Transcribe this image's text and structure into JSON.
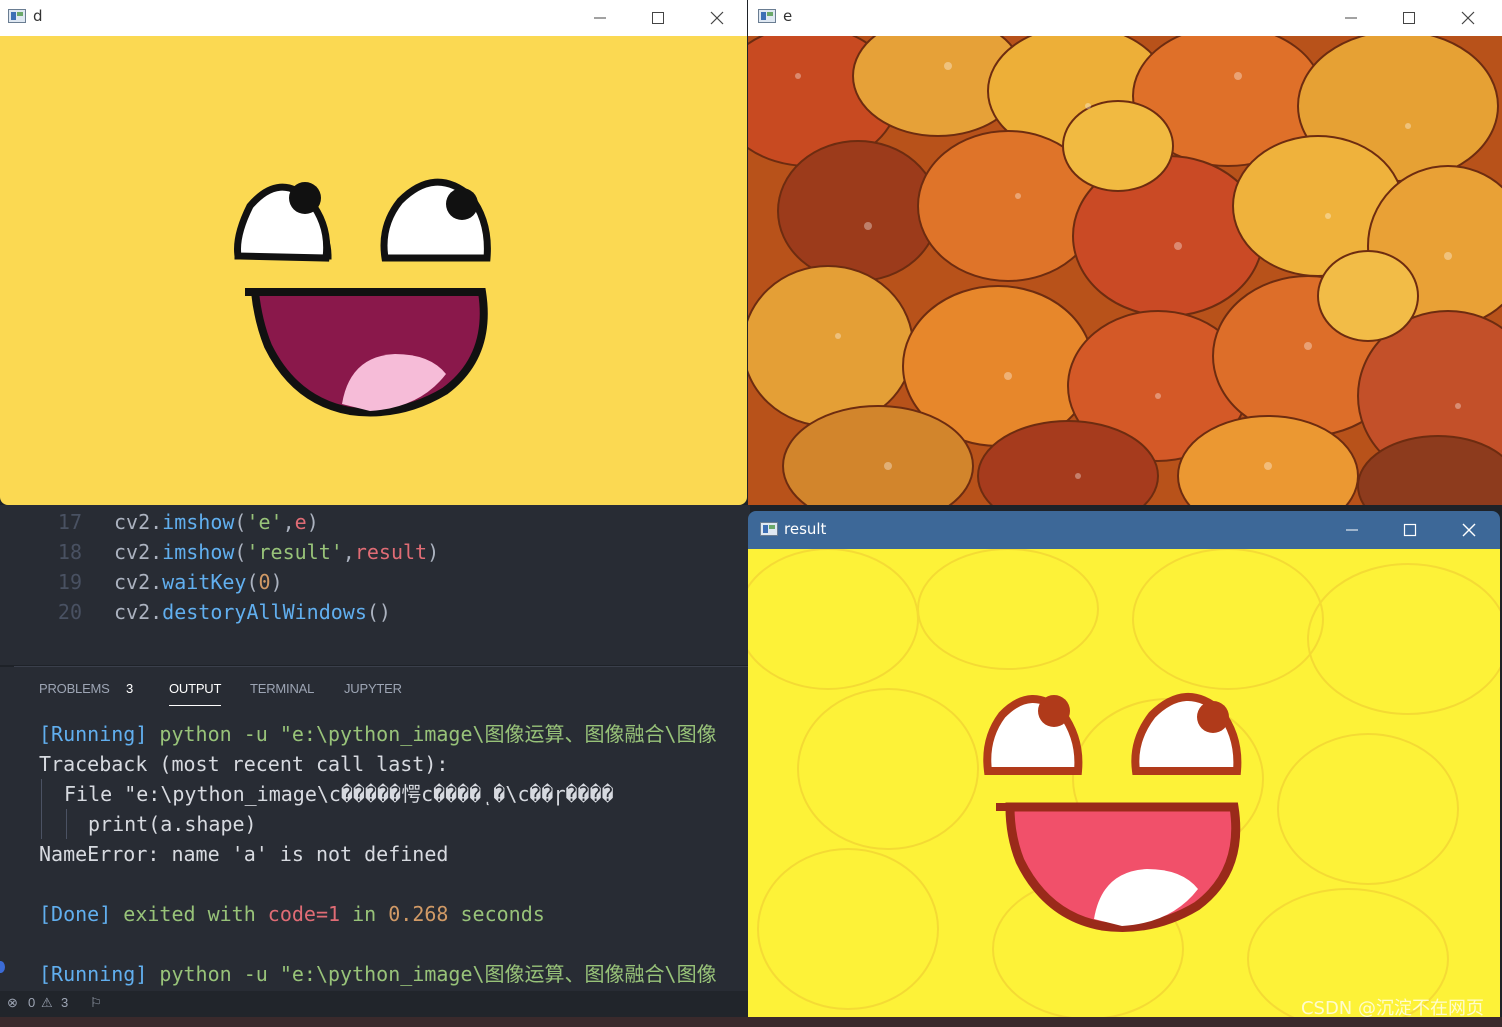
{
  "editor": {
    "lines": [
      {
        "num": "17",
        "parts": [
          {
            "t": "cv2.",
            "c": "def"
          },
          {
            "t": "imshow",
            "c": "fn"
          },
          {
            "t": "(",
            "c": "def"
          },
          {
            "t": "'e'",
            "c": "str"
          },
          {
            "t": ",",
            "c": "def"
          },
          {
            "t": "e",
            "c": "var"
          },
          {
            "t": ")",
            "c": "def"
          }
        ]
      },
      {
        "num": "18",
        "parts": [
          {
            "t": "cv2.",
            "c": "def"
          },
          {
            "t": "imshow",
            "c": "fn"
          },
          {
            "t": "(",
            "c": "def"
          },
          {
            "t": "'result'",
            "c": "str"
          },
          {
            "t": ",",
            "c": "def"
          },
          {
            "t": "result",
            "c": "var"
          },
          {
            "t": ")",
            "c": "def"
          }
        ]
      },
      {
        "num": "19",
        "parts": [
          {
            "t": "cv2.",
            "c": "def"
          },
          {
            "t": "waitKey",
            "c": "fn"
          },
          {
            "t": "(",
            "c": "def"
          },
          {
            "t": "0",
            "c": "num"
          },
          {
            "t": ")",
            "c": "def"
          }
        ]
      },
      {
        "num": "20",
        "parts": [
          {
            "t": "cv2.",
            "c": "def"
          },
          {
            "t": "destoryAllWindows",
            "c": "fn"
          },
          {
            "t": "()",
            "c": "def"
          }
        ]
      }
    ]
  },
  "panel": {
    "tabs": {
      "problems": "PROBLEMS",
      "problems_count": "3",
      "output": "OUTPUT",
      "terminal": "TERMINAL",
      "jupyter": "JUPYTER"
    },
    "output": {
      "run1_tag": "[Running]",
      "run1_cmd": "python -u \"e:\\python_image\\图像运算、图像融合\\图像",
      "traceback": "Traceback (most recent call last):",
      "file_line": "File \"e:\\python_image\\c�����愕c����ͺ�\\c��ɼ����",
      "print_line": "print(a.shape)",
      "error_line": "NameError: name 'a' is not defined",
      "done_tag": "[Done]",
      "done_exited": "exited with",
      "done_code": "code=1",
      "done_in": "in",
      "done_time": "0.268",
      "done_seconds": "seconds",
      "run2_tag": "[Running]",
      "run2_cmd": "python -u \"e:\\python_image\\图像运算、图像融合\\图像"
    }
  },
  "status": {
    "errors": "0",
    "warnings": "3"
  },
  "windows": {
    "d": {
      "title": "d"
    },
    "e": {
      "title": "e"
    },
    "result": {
      "title": "result"
    }
  },
  "watermark": "CSDN @沉淀不在网页",
  "colors": {
    "face_bg": "#fbd952",
    "mouth": "#8a184b",
    "tongue": "#f6bcd8",
    "leaf_orange": "#e0701e",
    "result_bg": "#fdf238",
    "result_titlebar": "#3d6898"
  }
}
